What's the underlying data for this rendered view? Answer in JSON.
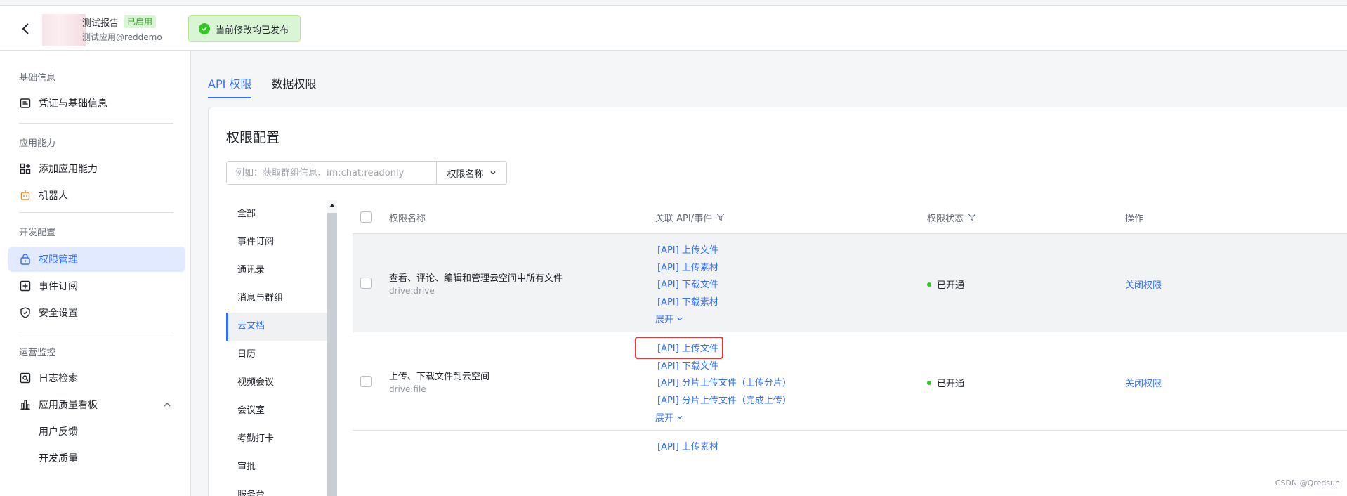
{
  "header": {
    "app_name": "测试报告",
    "app_status": "已启用",
    "app_sub": "测试应用@reddemo",
    "publish_tip": "当前修改均已发布"
  },
  "sidebar": {
    "sections": [
      {
        "title": "基础信息",
        "items": [
          {
            "label": "凭证与基础信息",
            "icon": "credential-icon"
          }
        ]
      },
      {
        "title": "应用能力",
        "items": [
          {
            "label": "添加应用能力",
            "icon": "app-grid-icon"
          },
          {
            "label": "机器人",
            "icon": "robot-icon"
          }
        ]
      },
      {
        "title": "开发配置",
        "items": [
          {
            "label": "权限管理",
            "icon": "lock-icon",
            "active": true
          },
          {
            "label": "事件订阅",
            "icon": "event-icon"
          },
          {
            "label": "安全设置",
            "icon": "shield-icon"
          }
        ]
      },
      {
        "title": "运营监控",
        "items": [
          {
            "label": "日志检索",
            "icon": "log-search-icon"
          },
          {
            "label": "应用质量看板",
            "icon": "bar-chart-icon"
          },
          {
            "label": "用户反馈"
          },
          {
            "label": "开发质量"
          }
        ]
      }
    ]
  },
  "tabs": [
    "API 权限",
    "数据权限"
  ],
  "card": {
    "title": "权限配置",
    "search_placeholder": "例如：获取群组信息、im:chat:readonly",
    "search_select": "权限名称"
  },
  "categories": [
    "全部",
    "事件订阅",
    "通讯录",
    "消息与群组",
    "云文档",
    "日历",
    "视频会议",
    "会议室",
    "考勤打卡",
    "审批",
    "服务台"
  ],
  "table": {
    "headers": {
      "name": "权限名称",
      "api": "关联 API/事件",
      "status": "权限状态",
      "op": "操作"
    },
    "rows": [
      {
        "name": "查看、评论、编辑和管理云空间中所有文件",
        "code": "drive:drive",
        "apis": [
          "[API] 上传文件",
          "[API] 上传素材",
          "[API] 下载文件",
          "[API] 下载素材"
        ],
        "expand": "展开",
        "status": "已开通",
        "op": "关闭权限"
      },
      {
        "name": "上传、下载文件到云空间",
        "code": "drive:file",
        "apis": [
          "[API] 上传文件",
          "[API] 下载文件",
          "[API] 分片上传文件（上传分片）",
          "[API] 分片上传文件（完成上传）"
        ],
        "expand": "展开",
        "status": "已开通",
        "op": "关闭权限"
      },
      {
        "apis": [
          "[API] 上传素材"
        ]
      }
    ]
  },
  "watermark": "CSDN @Qredsun"
}
